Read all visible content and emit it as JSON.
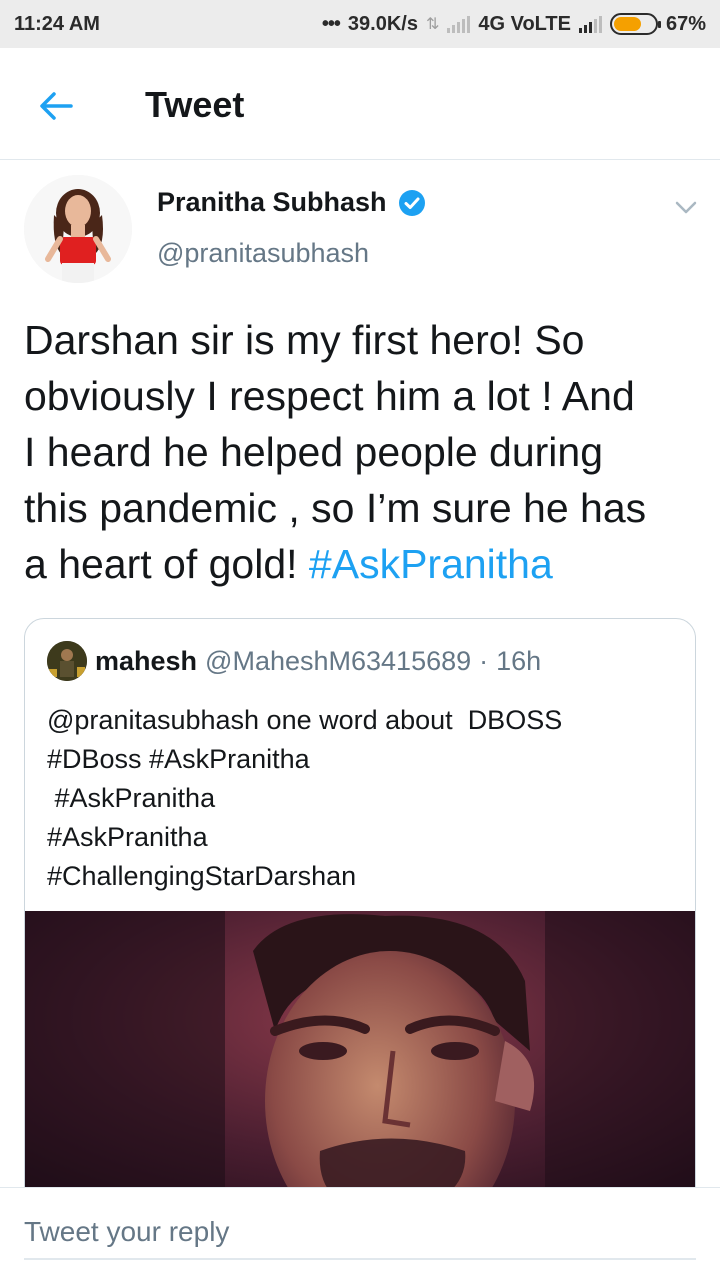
{
  "status_bar": {
    "time": "11:24 AM",
    "network_speed": "39.0K/s",
    "network_type": "4G VoLTE",
    "battery": "67%",
    "battery_level": 0.67
  },
  "header": {
    "title": "Tweet"
  },
  "tweet": {
    "author_name": "Pranitha Subhash",
    "author_handle": "@pranitasubhash",
    "verified": true,
    "text_lines": [
      "Darshan sir is my first hero! So",
      "obviously I respect him a lot ! And",
      "I heard he helped people during",
      "this pandemic , so I’m sure he has",
      "a heart of gold! "
    ],
    "hashtag": "#AskPranitha"
  },
  "quoted_tweet": {
    "author_name": "mahesh",
    "author_handle": "@MaheshM63415689",
    "separator": "·",
    "time": "16h",
    "text_lines": [
      "@pranitasubhash one word about  DBOSS",
      "#DBoss #AskPranitha",
      " #AskPranitha",
      "#AskPranitha",
      "#ChallengingStarDarshan"
    ]
  },
  "reply": {
    "placeholder": "Tweet your reply"
  },
  "colors": {
    "accent": "#1da1f2",
    "secondary_text": "#657786",
    "primary_text": "#14171a",
    "divider": "#e1e8ed"
  }
}
